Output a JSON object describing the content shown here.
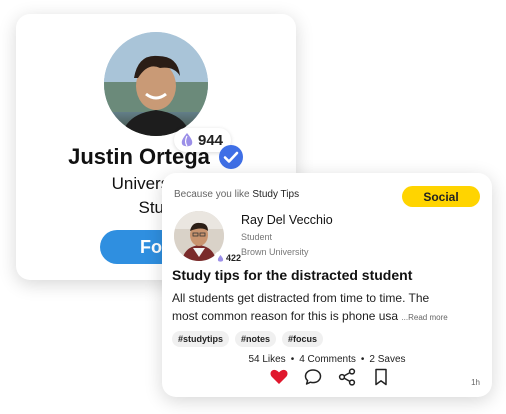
{
  "profile": {
    "karma": "944",
    "name": "Justin Ortega",
    "school_partial": "University o",
    "major_partial": "Stud",
    "follow_label": "Foll"
  },
  "post": {
    "because_prefix": "Because you like",
    "because_topic": "Study Tips",
    "category_tag": "Social",
    "author": {
      "name": "Ray Del Vecchio",
      "role": "Student",
      "school": "Brown University",
      "karma": "422"
    },
    "title": "Study tips for the distracted student",
    "body_line1": "All students get distracted from time to time.  The",
    "body_line2": "most common reason for this is phone usa",
    "read_more": "...Read more",
    "hashtags": [
      "#studytips",
      "#notes",
      "#focus"
    ],
    "likes": "54 Likes",
    "comments": "4 Comments",
    "saves": "2 Saves",
    "time": "1h"
  },
  "colors": {
    "verified": "#3f6fe6",
    "follow_button": "#2f8fe0",
    "social_tag": "#ffd400",
    "heart": "#e0182d"
  },
  "icons": [
    "karma-drop-icon",
    "verified-badge-icon",
    "heart-icon",
    "comment-icon",
    "share-icon",
    "bookmark-icon"
  ]
}
